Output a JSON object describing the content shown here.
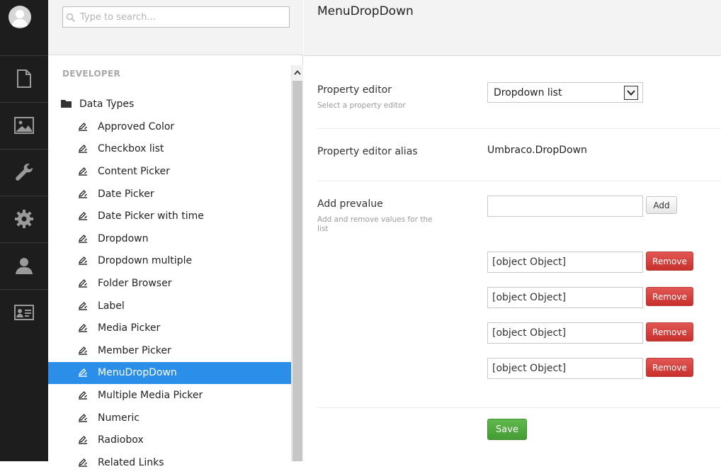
{
  "search": {
    "placeholder": "Type to search..."
  },
  "tree": {
    "section_title": "DEVELOPER",
    "root_label": "Data Types",
    "items": [
      "Approved Color",
      "Checkbox list",
      "Content Picker",
      "Date Picker",
      "Date Picker with time",
      "Dropdown",
      "Dropdown multiple",
      "Folder Browser",
      "Label",
      "Media Picker",
      "Member Picker",
      "MenuDropDown",
      "Multiple Media Picker",
      "Numeric",
      "Radiobox",
      "Related Links"
    ],
    "active_item": "MenuDropDown"
  },
  "editor": {
    "title": "MenuDropDown",
    "property_editor": {
      "label": "Property editor",
      "description": "Select a property editor",
      "selected": "Dropdown list"
    },
    "alias": {
      "label": "Property editor alias",
      "value": "Umbraco.DropDown"
    },
    "prevalue": {
      "label": "Add prevalue",
      "description": "Add and remove values for the list",
      "input_value": "",
      "add_label": "Add",
      "remove_label": "Remove",
      "values": [
        "[object Object]",
        "[object Object]",
        "[object Object]",
        "[object Object]"
      ]
    },
    "save_label": "Save"
  },
  "icons": {
    "sections": [
      "content-icon",
      "media-icon",
      "developer-icon",
      "settings-icon",
      "users-icon",
      "members-icon"
    ]
  },
  "colors": {
    "active_item": "#2b8ee8",
    "remove_button": "#d9534f",
    "save_button": "#53a93f",
    "app_bar": "#1d1d1d"
  }
}
